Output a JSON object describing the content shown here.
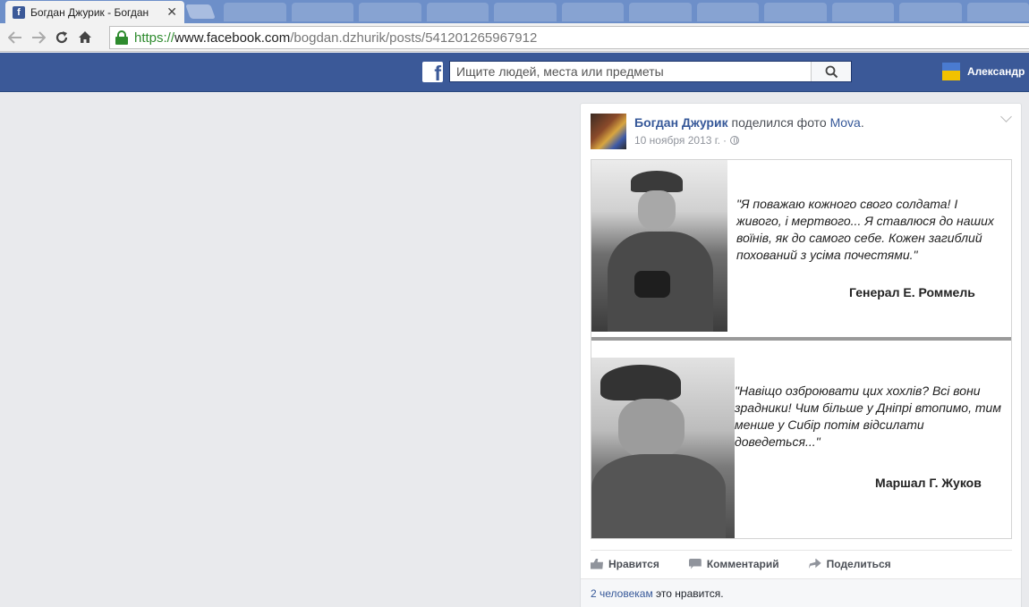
{
  "browser": {
    "tab_title": "Богдан Джурик - Богдан",
    "tab_close": "✕",
    "url_scheme": "https://",
    "url_host": "www.facebook.com",
    "url_path": "/bogdan.dzhurik/posts/541201265967912"
  },
  "fb": {
    "logo": "f",
    "search_placeholder": "Ищите людей, места или предметы",
    "user_name": "Александр"
  },
  "post": {
    "author": "Богдан Джурик",
    "action": "поделился фото",
    "page": "Mova",
    "period": ".",
    "date": "10 ноября 2013 г.",
    "sep": "·",
    "photo": {
      "quote1": "\"Я поважаю кожного свого солдата! І живого, і мертвого... Я ставлюся до наших воїнів, як до самого себе. Кожен загиблий похований з усіма почестями.\"",
      "sign1": "Генерал Е. Роммель",
      "quote2": "\"Навіщо озброювати цих хохлів? Всі вони зрадники! Чим більше у Дніпрі втопимо, тим менше у Сибір потім відсилати доведеться...\"",
      "sign2": "Маршал Г. Жуков"
    },
    "actions": {
      "like": "Нравится",
      "comment": "Комментарий",
      "share": "Поделиться"
    },
    "likes_link": "2 человекам",
    "likes_text": "это нравится."
  },
  "colors": {
    "fb_blue": "#3b5998",
    "link": "#365899",
    "secure_green": "#2e8b2e"
  },
  "icons": [
    "facebook-tab-icon",
    "back-icon",
    "forward-icon",
    "reload-icon",
    "home-icon",
    "lock-icon",
    "facebook-logo-icon",
    "search-icon",
    "globe-icon",
    "chevron-down-icon",
    "like-icon",
    "comment-icon",
    "share-icon"
  ]
}
